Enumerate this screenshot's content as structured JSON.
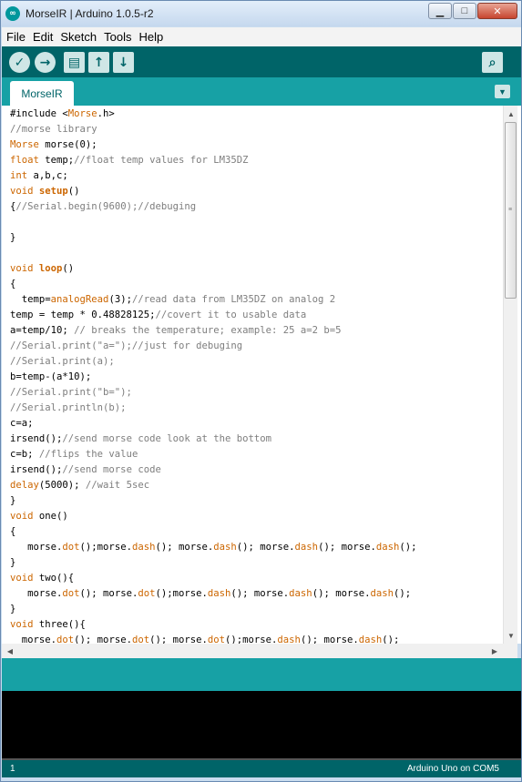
{
  "window": {
    "title": "MorseIR | Arduino 1.0.5-r2",
    "app_icon_glyph": "∞",
    "controls": {
      "minimize": "▁",
      "maximize": "□",
      "close": "✕"
    }
  },
  "menu": [
    "File",
    "Edit",
    "Sketch",
    "Tools",
    "Help"
  ],
  "toolbar": {
    "verify_icon": "✓",
    "upload_icon": "→",
    "new_icon": "▤",
    "open_icon": "↑",
    "save_icon": "↓",
    "serial_monitor_icon": "⌕"
  },
  "tabs": [
    {
      "label": "MorseIR"
    }
  ],
  "tab_menu_icon": "▼",
  "code_lines": [
    [
      {
        "t": "#include <"
      },
      {
        "t": "Morse",
        "c": "kw"
      },
      {
        "t": ".h>"
      }
    ],
    [
      {
        "t": "//morse library",
        "c": "cm"
      }
    ],
    [
      {
        "t": "Morse",
        "c": "kw"
      },
      {
        "t": " morse(0);"
      }
    ],
    [
      {
        "t": "float",
        "c": "kw"
      },
      {
        "t": " temp;"
      },
      {
        "t": "//float temp values for LM35DZ",
        "c": "cm"
      }
    ],
    [
      {
        "t": "int",
        "c": "kw"
      },
      {
        "t": " a,b,c;"
      }
    ],
    [
      {
        "t": "void",
        "c": "kw"
      },
      {
        "t": " "
      },
      {
        "t": "setup",
        "c": "kwb"
      },
      {
        "t": "()"
      }
    ],
    [
      {
        "t": "{"
      },
      {
        "t": "//Serial.begin(9600);//debuging",
        "c": "cm"
      }
    ],
    [
      {
        "t": ""
      }
    ],
    [
      {
        "t": "}"
      }
    ],
    [
      {
        "t": ""
      }
    ],
    [
      {
        "t": "void",
        "c": "kw"
      },
      {
        "t": " "
      },
      {
        "t": "loop",
        "c": "kwb"
      },
      {
        "t": "()"
      }
    ],
    [
      {
        "t": "{"
      }
    ],
    [
      {
        "t": "  temp="
      },
      {
        "t": "analogRead",
        "c": "kw"
      },
      {
        "t": "(3);"
      },
      {
        "t": "//read data from LM35DZ on analog 2",
        "c": "cm"
      }
    ],
    [
      {
        "t": "temp = temp * 0.48828125;"
      },
      {
        "t": "//covert it to usable data",
        "c": "cm"
      }
    ],
    [
      {
        "t": "a=temp/10; "
      },
      {
        "t": "// breaks the temperature; example: 25 a=2 b=5",
        "c": "cm"
      }
    ],
    [
      {
        "t": "//Serial.print(\"a=\");//just for debuging",
        "c": "cm"
      }
    ],
    [
      {
        "t": "//Serial.print(a);",
        "c": "cm"
      }
    ],
    [
      {
        "t": "b=temp-(a*10);"
      }
    ],
    [
      {
        "t": "//Serial.print(\"b=\");",
        "c": "cm"
      }
    ],
    [
      {
        "t": "//Serial.println(b);",
        "c": "cm"
      }
    ],
    [
      {
        "t": "c=a;"
      }
    ],
    [
      {
        "t": "irsend();"
      },
      {
        "t": "//send morse code look at the bottom",
        "c": "cm"
      }
    ],
    [
      {
        "t": "c=b; "
      },
      {
        "t": "//flips the value",
        "c": "cm"
      }
    ],
    [
      {
        "t": "irsend();"
      },
      {
        "t": "//send morse code",
        "c": "cm"
      }
    ],
    [
      {
        "t": "delay",
        "c": "kw"
      },
      {
        "t": "(5000); "
      },
      {
        "t": "//wait 5sec",
        "c": "cm"
      }
    ],
    [
      {
        "t": "}"
      }
    ],
    [
      {
        "t": "void",
        "c": "kw"
      },
      {
        "t": " one()"
      }
    ],
    [
      {
        "t": "{"
      }
    ],
    [
      {
        "t": "   morse."
      },
      {
        "t": "dot",
        "c": "kw"
      },
      {
        "t": "();morse."
      },
      {
        "t": "dash",
        "c": "kw"
      },
      {
        "t": "(); morse."
      },
      {
        "t": "dash",
        "c": "kw"
      },
      {
        "t": "(); morse."
      },
      {
        "t": "dash",
        "c": "kw"
      },
      {
        "t": "(); morse."
      },
      {
        "t": "dash",
        "c": "kw"
      },
      {
        "t": "();"
      }
    ],
    [
      {
        "t": "}"
      }
    ],
    [
      {
        "t": "void",
        "c": "kw"
      },
      {
        "t": " two(){"
      }
    ],
    [
      {
        "t": "   morse."
      },
      {
        "t": "dot",
        "c": "kw"
      },
      {
        "t": "(); morse."
      },
      {
        "t": "dot",
        "c": "kw"
      },
      {
        "t": "();morse."
      },
      {
        "t": "dash",
        "c": "kw"
      },
      {
        "t": "(); morse."
      },
      {
        "t": "dash",
        "c": "kw"
      },
      {
        "t": "(); morse."
      },
      {
        "t": "dash",
        "c": "kw"
      },
      {
        "t": "();"
      }
    ],
    [
      {
        "t": "}"
      }
    ],
    [
      {
        "t": "void",
        "c": "kw"
      },
      {
        "t": " three(){"
      }
    ],
    [
      {
        "t": "  morse."
      },
      {
        "t": "dot",
        "c": "kw"
      },
      {
        "t": "(); morse."
      },
      {
        "t": "dot",
        "c": "kw"
      },
      {
        "t": "(); morse."
      },
      {
        "t": "dot",
        "c": "kw"
      },
      {
        "t": "();morse."
      },
      {
        "t": "dash",
        "c": "kw"
      },
      {
        "t": "(); morse."
      },
      {
        "t": "dash",
        "c": "kw"
      },
      {
        "t": "();"
      }
    ]
  ],
  "scrollbar": {
    "up": "▲",
    "down": "▼",
    "left": "◀",
    "right": "▶",
    "grip": "≡"
  },
  "status": {
    "line_number": "1",
    "board": "Arduino Uno on COM5"
  },
  "colors": {
    "teal_dark": "#006468",
    "teal_light": "#17a1a5",
    "keyword": "#cc6600",
    "comment": "#7e7e7e"
  }
}
